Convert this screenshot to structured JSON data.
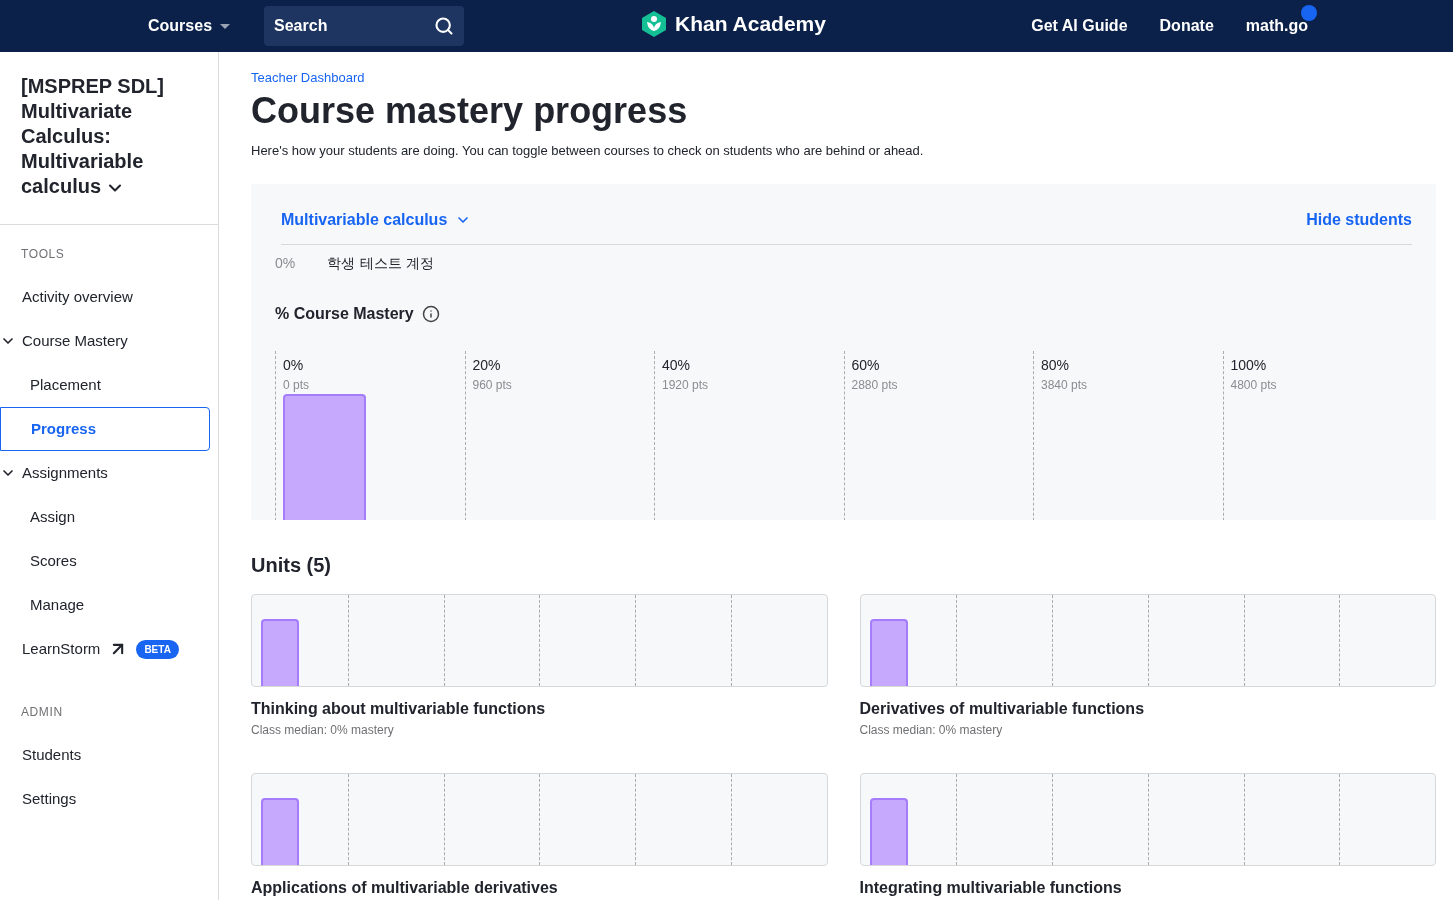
{
  "header": {
    "courses": "Courses",
    "search": {
      "placeholder": "Search"
    },
    "logo": "Khan Academy",
    "links": [
      "Get AI Guide",
      "Donate"
    ],
    "user": "math.go",
    "notification": true
  },
  "sidebar": {
    "class_name": "[MSPREP SDL] Multivariate Calculus: Multivariable calculus",
    "sections": [
      {
        "title": "TOOLS",
        "items": [
          {
            "label": "Activity overview",
            "kind": "link",
            "selected": false
          },
          {
            "label": "Course Mastery",
            "kind": "group",
            "expanded": true,
            "children": [
              {
                "label": "Placement",
                "selected": false
              },
              {
                "label": "Progress",
                "selected": true
              }
            ]
          },
          {
            "label": "Assignments",
            "kind": "group",
            "expanded": true,
            "children": [
              {
                "label": "Assign",
                "selected": false
              },
              {
                "label": "Scores",
                "selected": false
              },
              {
                "label": "Manage",
                "selected": false
              }
            ]
          },
          {
            "label": "LearnStorm",
            "kind": "external",
            "badge": "BETA",
            "selected": false
          }
        ]
      },
      {
        "title": "ADMIN",
        "items": [
          {
            "label": "Students",
            "kind": "link",
            "selected": false
          },
          {
            "label": "Settings",
            "kind": "link",
            "selected": false
          }
        ]
      }
    ]
  },
  "breadcrumb": "Teacher Dashboard",
  "title": "Course mastery progress",
  "description": "Here's how your students are doing. You can toggle between courses to check on students who are behind or ahead.",
  "panel": {
    "course": "Multivariable calculus",
    "toggle": "Hide students",
    "students": [
      {
        "percent": "0%",
        "name": "학생 테스트 계정"
      }
    ],
    "chart_title": "% Course Mastery",
    "bins": [
      {
        "label": "0%",
        "points": "0 pts",
        "filled": true
      },
      {
        "label": "20%",
        "points": "960 pts",
        "filled": false
      },
      {
        "label": "40%",
        "points": "1920 pts",
        "filled": false
      },
      {
        "label": "60%",
        "points": "2880 pts",
        "filled": false
      },
      {
        "label": "80%",
        "points": "3840 pts",
        "filled": false
      },
      {
        "label": "100%",
        "points": "4800 pts",
        "filled": false
      }
    ]
  },
  "units": {
    "title": "Units (5)",
    "items": [
      {
        "name": "Thinking about multivariable functions",
        "median": "Class median: 0% mastery"
      },
      {
        "name": "Derivatives of multivariable functions",
        "median": "Class median: 0% mastery"
      },
      {
        "name": "Applications of multivariable derivatives"
      },
      {
        "name": "Integrating multivariable functions"
      }
    ]
  }
}
